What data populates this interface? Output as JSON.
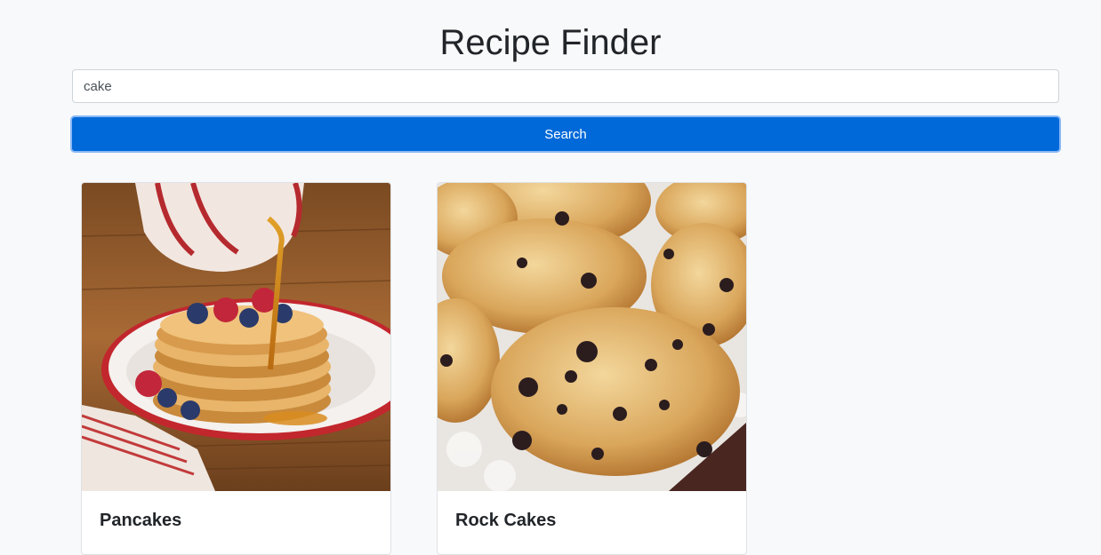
{
  "page": {
    "title": "Recipe Finder"
  },
  "search": {
    "value": "cake",
    "button_label": "Search"
  },
  "recipes": [
    {
      "title": "Pancakes",
      "image": "pancakes-photo"
    },
    {
      "title": "Rock Cakes",
      "image": "rock-cakes-photo"
    }
  ],
  "colors": {
    "background": "#f8f9fa",
    "primary": "#0069d9",
    "text": "#212529"
  }
}
